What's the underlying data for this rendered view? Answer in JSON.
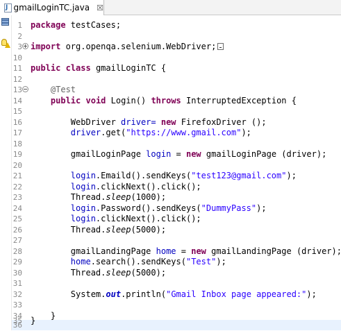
{
  "tab": {
    "title": "gmailLoginTC.java",
    "close_glyph": "☒"
  },
  "icons": {
    "tab_file": "java-file-icon",
    "bookmark": "bookmark-icon",
    "warning": "quickfix-warning-icon",
    "fold": "fold-toggle-icon"
  },
  "lines": [
    {
      "n": "1",
      "text": "package testCases;"
    },
    {
      "n": "2",
      "text": ""
    },
    {
      "n": "3",
      "text": "import org.openqa.selenium.WebDriver;"
    },
    {
      "n": "10",
      "text": ""
    },
    {
      "n": "11",
      "text": "public class gmailLoginTC {"
    },
    {
      "n": "12",
      "text": ""
    },
    {
      "n": "13",
      "text": "@Test"
    },
    {
      "n": "14",
      "text": "public void Login() throws InterruptedException {"
    },
    {
      "n": "15",
      "text": ""
    },
    {
      "n": "16",
      "text": "WebDriver driver= new FirefoxDriver ();"
    },
    {
      "n": "17",
      "text": "driver.get(\"https://www.gmail.com\");"
    },
    {
      "n": "18",
      "text": ""
    },
    {
      "n": "19",
      "text": "gmailLoginPage login = new gmailLoginPage (driver);"
    },
    {
      "n": "20",
      "text": ""
    },
    {
      "n": "21",
      "text": "login.Emaild().sendKeys(\"test123@gmail.com\");"
    },
    {
      "n": "22",
      "text": "login.clickNext().click();"
    },
    {
      "n": "23",
      "text": "Thread.sleep(1000);"
    },
    {
      "n": "24",
      "text": "login.Password().sendKeys(\"DummyPass\");"
    },
    {
      "n": "25",
      "text": "login.clickNext().click();"
    },
    {
      "n": "26",
      "text": "Thread.sleep(5000);"
    },
    {
      "n": "27",
      "text": ""
    },
    {
      "n": "28",
      "text": "gmailLandingPage home = new gmailLandingPage (driver);"
    },
    {
      "n": "29",
      "text": "home.search().sendKeys(\"Test\");"
    },
    {
      "n": "30",
      "text": "Thread.sleep(5000);"
    },
    {
      "n": "31",
      "text": ""
    },
    {
      "n": "32",
      "text": "System.out.println(\"Gmail Inbox page appeared:\");"
    },
    {
      "n": "33",
      "text": ""
    },
    {
      "n": "34",
      "text": "}"
    },
    {
      "n": "35",
      "text": "}"
    },
    {
      "n": "36",
      "text": ""
    }
  ],
  "tokens": {
    "package": "package",
    "testCases": " testCases;",
    "import": "import",
    "import_path": " org.openqa.selenium.WebDriver;",
    "public": "public",
    "class": "class",
    "class_name": " gmailLoginTC {",
    "annotation": "@Test",
    "void": "void",
    "login_sig": " Login() ",
    "throws": "throws",
    "exc": " InterruptedException {",
    "webdriver_decl": "WebDriver ",
    "driver_eq": "driver= ",
    "new": "new",
    "firefox": " FirefoxDriver ();",
    "driver_get": "driver",
    "get_call": ".get(",
    "url": "\"https://www.gmail.com\"",
    "close_paren": ");",
    "glp_type": "gmailLoginPage ",
    "login_var": "login",
    "eq": " = ",
    "glp_ctor": " gmailLoginPage (driver);",
    "emaild_call": ".Emaild().sendKeys(",
    "email_str": "\"test123@gmail.com\"",
    "clicknext": ".clickNext().click();",
    "thread": "Thread.",
    "sleep": "sleep",
    "sleep_1000": "(1000);",
    "sleep_5000": "(5000);",
    "password_call": ".Password().sendKeys(",
    "pass_str": "\"DummyPass\"",
    "glandp_type": "gmailLandingPage ",
    "home_var": "home",
    "glandp_ctor": " gmailLandingPage (driver);",
    "search_call": ".search().sendKeys(",
    "test_str": "\"Test\"",
    "system": "System.",
    "out": "out",
    "println": ".println(",
    "inbox_str": "\"Gmail Inbox page appeared:\"",
    "brace": "}"
  },
  "colors": {
    "keyword": "#7f0055",
    "string": "#2a00ff",
    "annotation": "#646464",
    "field": "#0000c0",
    "line_number": "#8a8a8a"
  }
}
